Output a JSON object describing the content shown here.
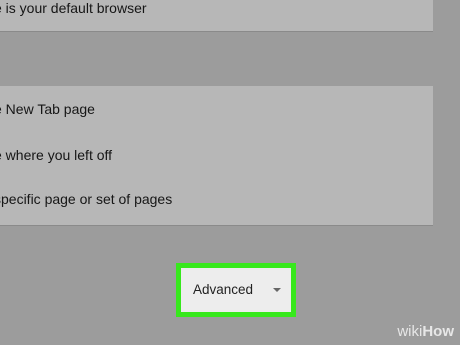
{
  "default_browser": {
    "text": "e is your default browser"
  },
  "startup": {
    "options": [
      {
        "label": "e New Tab page"
      },
      {
        "label": "e where you left off"
      },
      {
        "label": "specific page or set of pages"
      }
    ]
  },
  "advanced_button": {
    "label": "Advanced",
    "icon": "dropdown-arrow-icon",
    "highlight_color": "#37e81c"
  },
  "watermark": {
    "part1": "wiki",
    "part2": "How"
  }
}
